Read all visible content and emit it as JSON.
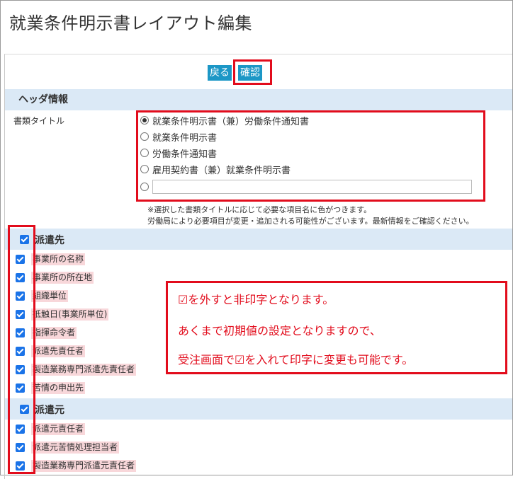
{
  "page": {
    "title": "就業条件明示書レイアウト編集"
  },
  "toolbar": {
    "back_label": "戻る",
    "confirm_label": "確認"
  },
  "header_section": {
    "title": "ヘッダ情報",
    "doc_title_label": "書類タイトル",
    "options": [
      {
        "label": "就業条件明示書（兼）労働条件通知書",
        "selected": true
      },
      {
        "label": "就業条件明示書",
        "selected": false
      },
      {
        "label": "労働条件通知書",
        "selected": false
      },
      {
        "label": "雇用契約書（兼）就業条件明示書",
        "selected": false
      },
      {
        "label": "",
        "selected": false,
        "custom": true
      }
    ],
    "custom_value": "",
    "notes": [
      "※選択した書類タイトルに応じて必要な項目名に色がつきます。",
      "労働局により必要項目が変更・追加される可能性がございます。最新情報をご確認ください。"
    ]
  },
  "dispatch_to": {
    "title": "派遣先",
    "checked": true,
    "items": [
      {
        "label": "事業所の名称",
        "checked": true
      },
      {
        "label": "事業所の所在地",
        "checked": true
      },
      {
        "label": "組織単位",
        "checked": true
      },
      {
        "label": "抵触日(事業所単位)",
        "checked": true
      },
      {
        "label": "指揮命令者",
        "checked": true
      },
      {
        "label": "派遣先責任者",
        "checked": true
      },
      {
        "label": "製造業務専門派遣先責任者",
        "checked": true
      },
      {
        "label": "苦情の申出先",
        "checked": true
      }
    ]
  },
  "dispatch_from": {
    "title": "派遣元",
    "checked": true,
    "items": [
      {
        "label": "派遣元責任者",
        "checked": true
      },
      {
        "label": "派遣元苦情処理担当者",
        "checked": true
      },
      {
        "label": "製造業務専門派遣元責任者",
        "checked": true
      }
    ]
  },
  "callout": {
    "lines": [
      "☑を外すと非印字となります。",
      "あくまで初期値の設定となりますので、",
      "受注画面で☑を入れて印字に変更も可能です。"
    ]
  },
  "colors": {
    "accent": "#1c97c6",
    "highlight_red": "#e20c1c",
    "section_bg": "#dbe9f6",
    "checkbox": "#1a73e8",
    "required_bg": "#f8d7da"
  }
}
